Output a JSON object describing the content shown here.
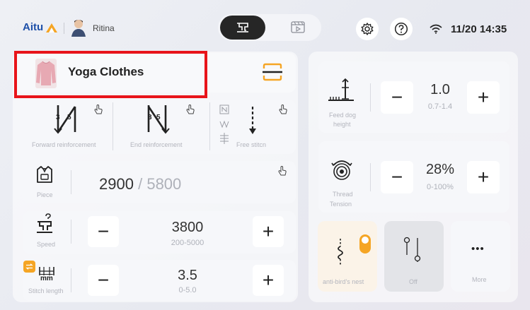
{
  "status_bar": {
    "brand": "Aitu",
    "username": "Ritina",
    "datetime": "11/20 14:35"
  },
  "garment": {
    "name": "Yoga Clothes"
  },
  "reinforcement": {
    "forward_label": "Forward reinforcement",
    "end_label": "End reinforcement",
    "free_stitch_label": "Free stitcn",
    "forward_numbers": [
      "3",
      "5"
    ],
    "end_numbers": [
      "3",
      "5"
    ]
  },
  "piece": {
    "label": "Piece",
    "current": "2900",
    "separator": "/",
    "total": "5800"
  },
  "speed": {
    "label": "Speed",
    "value": "3800",
    "range": "200-5000",
    "minus": "−",
    "plus": "+"
  },
  "stitch_length": {
    "label": "Stitch length",
    "unit": "mm",
    "value": "3.5",
    "range": "0-5.0",
    "minus": "−",
    "plus": "+"
  },
  "feed_dog": {
    "label_line1": "Feed dog",
    "label_line2": "height",
    "value": "1.0",
    "range": "0.7-1.4",
    "minus": "−",
    "plus": "+"
  },
  "thread_tension": {
    "label_line1": "Thread",
    "label_line2": "Tension",
    "value": "28%",
    "range": "0-100%",
    "minus": "−",
    "plus": "+"
  },
  "tiles": {
    "anti_bird_label": "anti-bird's nest",
    "off_label": "Off",
    "more_label": "More",
    "more_dots": "•••"
  },
  "colors": {
    "accent_orange": "#f5a524",
    "highlight_red": "#e8141a",
    "brand_text": "#1d4fa8"
  }
}
